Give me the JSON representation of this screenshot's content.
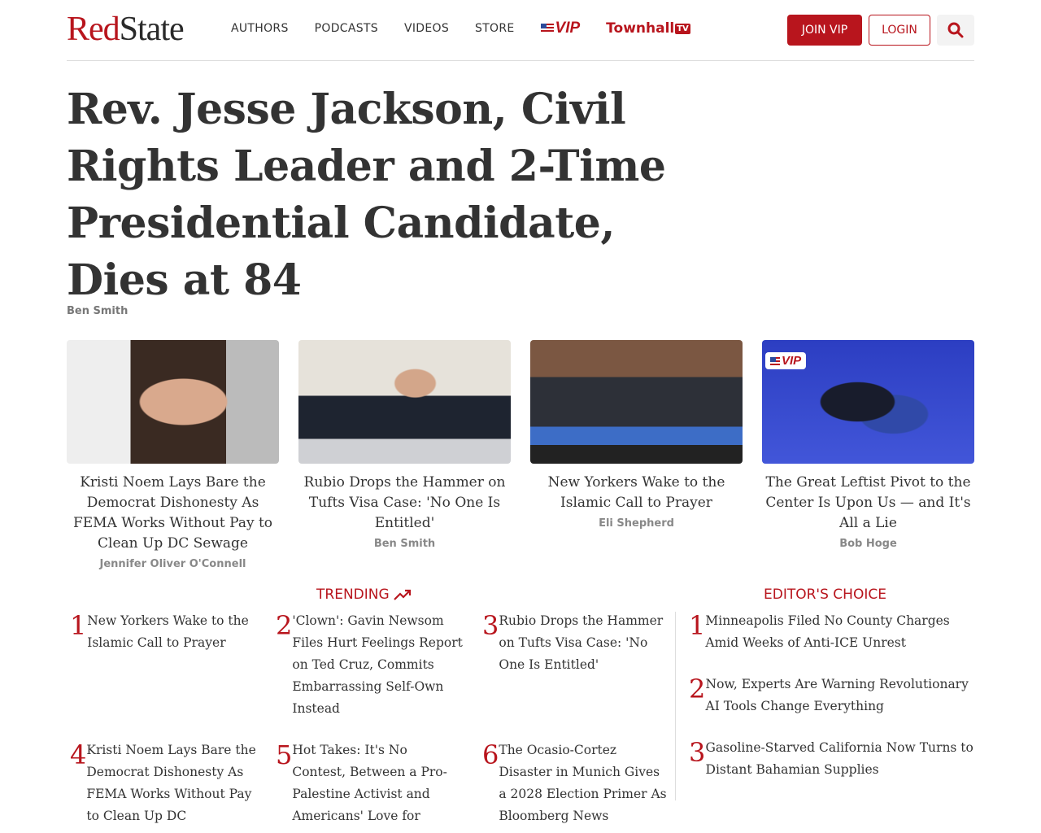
{
  "header": {
    "logo_red": "Red",
    "logo_black": "State",
    "nav": [
      "AUTHORS",
      "PODCASTS",
      "VIDEOS",
      "STORE"
    ],
    "vip_label": "VIP",
    "townhall_label": "Townhall",
    "townhall_tv": "TV",
    "join_label": "JOIN VIP",
    "login_label": "LOGIN"
  },
  "headline": {
    "title": "Rev. Jesse Jackson, Civil Rights Leader and 2-Time Presidential Candidate, Dies at 84",
    "author": "Ben Smith"
  },
  "cards": [
    {
      "title": "Kristi Noem Lays Bare the Democrat Dishonesty As FEMA Works Without Pay to Clean Up DC Sewage",
      "author": "Jennifer Oliver O'Connell"
    },
    {
      "title": "Rubio Drops the Hammer on Tufts Visa Case: 'No One Is Entitled'",
      "author": "Ben Smith"
    },
    {
      "title": "New Yorkers Wake to the Islamic Call to Prayer",
      "author": "Eli Shepherd"
    },
    {
      "title": "The Great Leftist Pivot to the Center Is Upon Us — and It's All a Lie",
      "author": "Bob Hoge",
      "vip": "VIP"
    }
  ],
  "trending": {
    "heading": "TRENDING",
    "items": [
      {
        "num": "1",
        "title": "New Yorkers Wake to the Islamic Call to Prayer"
      },
      {
        "num": "2",
        "title": "'Clown': Gavin Newsom Files Hurt Feelings Report on Ted Cruz, Commits Embarrassing Self-Own Instead"
      },
      {
        "num": "3",
        "title": "Rubio Drops the Hammer on Tufts Visa Case: 'No One Is Entitled'"
      },
      {
        "num": "4",
        "title": "Kristi Noem Lays Bare the Democrat Dishonesty As FEMA Works Without Pay to Clean Up DC"
      },
      {
        "num": "5",
        "title": "Hot Takes: It's No Contest, Between a Pro-Palestine Activist and Americans' Love for"
      },
      {
        "num": "6",
        "title": "The Ocasio-Cortez Disaster in Munich Gives a 2028 Election Primer As Bloomberg News"
      }
    ]
  },
  "editors": {
    "heading": "EDITOR'S CHOICE",
    "items": [
      {
        "num": "1",
        "title": "Minneapolis Filed No County Charges Amid Weeks of Anti-ICE Unrest"
      },
      {
        "num": "2",
        "title": "Now, Experts Are Warning Revolutionary AI Tools Change Everything"
      },
      {
        "num": "3",
        "title": "Gasoline-Starved California Now Turns to Distant Bahamian Supplies"
      }
    ]
  }
}
